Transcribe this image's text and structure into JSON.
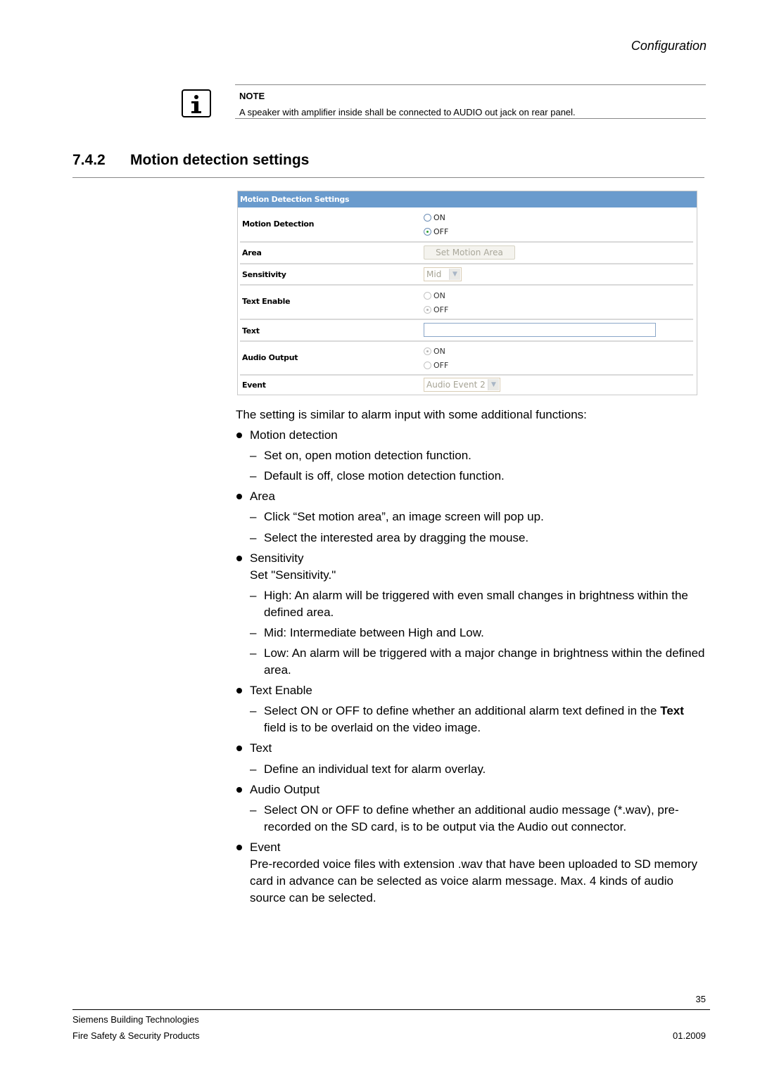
{
  "header": {
    "running_title": "Configuration"
  },
  "note": {
    "icon": "info-icon",
    "title": "NOTE",
    "text": "A speaker with amplifier inside shall be connected to AUDIO out jack on rear panel."
  },
  "section": {
    "number": "7.4.2",
    "title": "Motion detection settings"
  },
  "settings_panel": {
    "title": "Motion Detection Settings",
    "rows": {
      "motion_detection": {
        "label": "Motion Detection",
        "options": [
          "ON",
          "OFF"
        ],
        "selected": "OFF",
        "enabled": true
      },
      "area": {
        "label": "Area",
        "button_label": "Set Motion Area",
        "enabled": false
      },
      "sensitivity": {
        "label": "Sensitivity",
        "value": "Mid",
        "enabled": false
      },
      "text_enable": {
        "label": "Text Enable",
        "options": [
          "ON",
          "OFF"
        ],
        "selected": "OFF",
        "enabled": false
      },
      "text": {
        "label": "Text",
        "value": ""
      },
      "audio_output": {
        "label": "Audio Output",
        "options": [
          "ON",
          "OFF"
        ],
        "selected": "ON",
        "enabled": false
      },
      "event": {
        "label": "Event",
        "value": "Audio Event 2",
        "enabled": false
      }
    }
  },
  "body": {
    "intro": "The setting is similar to alarm input with some additional functions:",
    "motion_detection": {
      "title": "Motion detection",
      "items": [
        "Set on, open motion detection function.",
        "Default is off, close motion detection function."
      ]
    },
    "area": {
      "title": "Area",
      "items": [
        "Click “Set motion area”, an image screen will pop up.",
        "Select the interested area by dragging the mouse."
      ]
    },
    "sensitivity": {
      "title": "Sensitivity",
      "subtitle": "Set \"Sensitivity.\"",
      "items": [
        "High: An alarm will be triggered with even small changes in brightness within the defined area.",
        "Mid: Intermediate between High and Low.",
        "Low: An alarm will be triggered with a major change in brightness within the defined area."
      ]
    },
    "text_enable": {
      "title": "Text Enable",
      "item_pre": "Select ON or OFF to define whether an additional alarm text defined in the ",
      "item_bold": "Text",
      "item_post": " field is to be overlaid on the video image."
    },
    "text": {
      "title": "Text",
      "items": [
        "Define an individual text for alarm overlay."
      ]
    },
    "audio_output": {
      "title": "Audio Output",
      "items": [
        "Select ON or OFF to define whether an additional audio message (*.wav), pre-recorded on the SD card, is to be output via the Audio out connector."
      ]
    },
    "event": {
      "title": "Event",
      "paragraph": "Pre-recorded voice files with extension .wav that have been uploaded to SD memory card in advance can be selected as voice alarm message. Max. 4 kinds of audio source can be selected."
    },
    "dash_glyph": "–"
  },
  "footer": {
    "page_number": "35",
    "company": "Siemens Building Technologies",
    "division": "Fire Safety & Security Products",
    "date": "01.2009"
  }
}
